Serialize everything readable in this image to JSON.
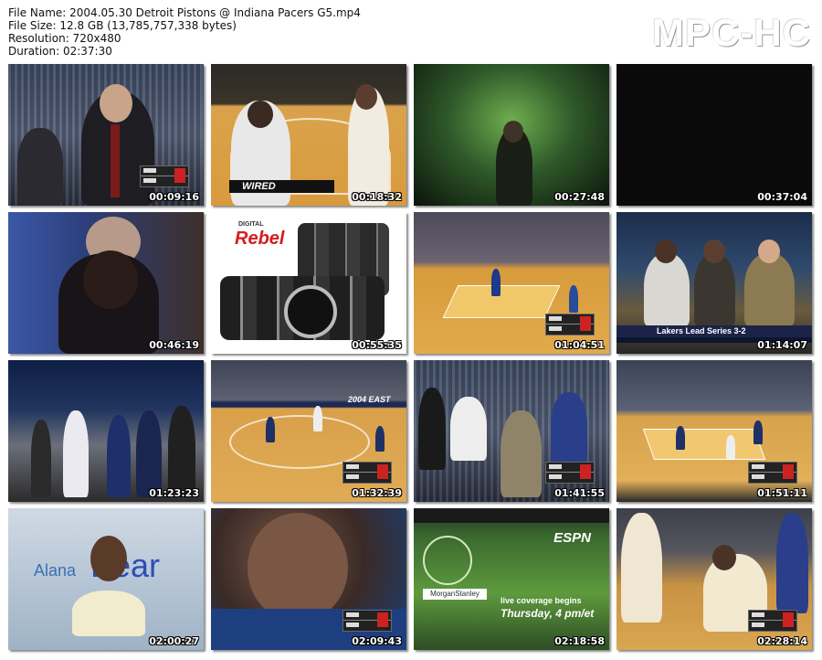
{
  "file_info": {
    "name": "File Name: 2004.05.30 Detroit Pistons @ Indiana Pacers G5.mp4",
    "size": "File Size: 12.8 GB (13,785,757,338 bytes)",
    "resolution": "Resolution: 720x480",
    "duration": "Duration: 02:37:30"
  },
  "logo": "MPC-HC",
  "thumbnails": [
    {
      "time": "00:09:16",
      "scene": "coach-sideline"
    },
    {
      "time": "00:18:32",
      "scene": "referee-court",
      "caption": "WIRED"
    },
    {
      "time": "00:27:48",
      "scene": "green-tunnel"
    },
    {
      "time": "00:37:04",
      "scene": "black-frame"
    },
    {
      "time": "00:46:19",
      "scene": "bench-huddle"
    },
    {
      "time": "00:55:35",
      "scene": "camera-ad",
      "caption": "Rebel",
      "caption_small": "DIGITAL"
    },
    {
      "time": "01:04:51",
      "scene": "court-wide"
    },
    {
      "time": "01:14:07",
      "scene": "studio",
      "caption": "Lakers Lead Series 3-2"
    },
    {
      "time": "01:23:23",
      "scene": "arena-team"
    },
    {
      "time": "01:32:39",
      "scene": "court-play",
      "caption": "2004 EAST"
    },
    {
      "time": "01:41:55",
      "scene": "crowd"
    },
    {
      "time": "01:51:11",
      "scene": "court-wide-2"
    },
    {
      "time": "02:00:27",
      "scene": "music-video",
      "caption": "Bear",
      "caption_small": "Alana"
    },
    {
      "time": "02:09:43",
      "scene": "player-closeup"
    },
    {
      "time": "02:18:58",
      "scene": "espn-promo",
      "caption": "ESPN",
      "caption_line1": "live coverage begins",
      "caption_line2": "Thursday, 4 pm/et",
      "sponsor": "MorganStanley"
    },
    {
      "time": "02:28:14",
      "scene": "player-floor"
    }
  ],
  "colors": {
    "background": "#ffffff",
    "timestamp": "#ffffff",
    "logo": "#ffffff"
  }
}
